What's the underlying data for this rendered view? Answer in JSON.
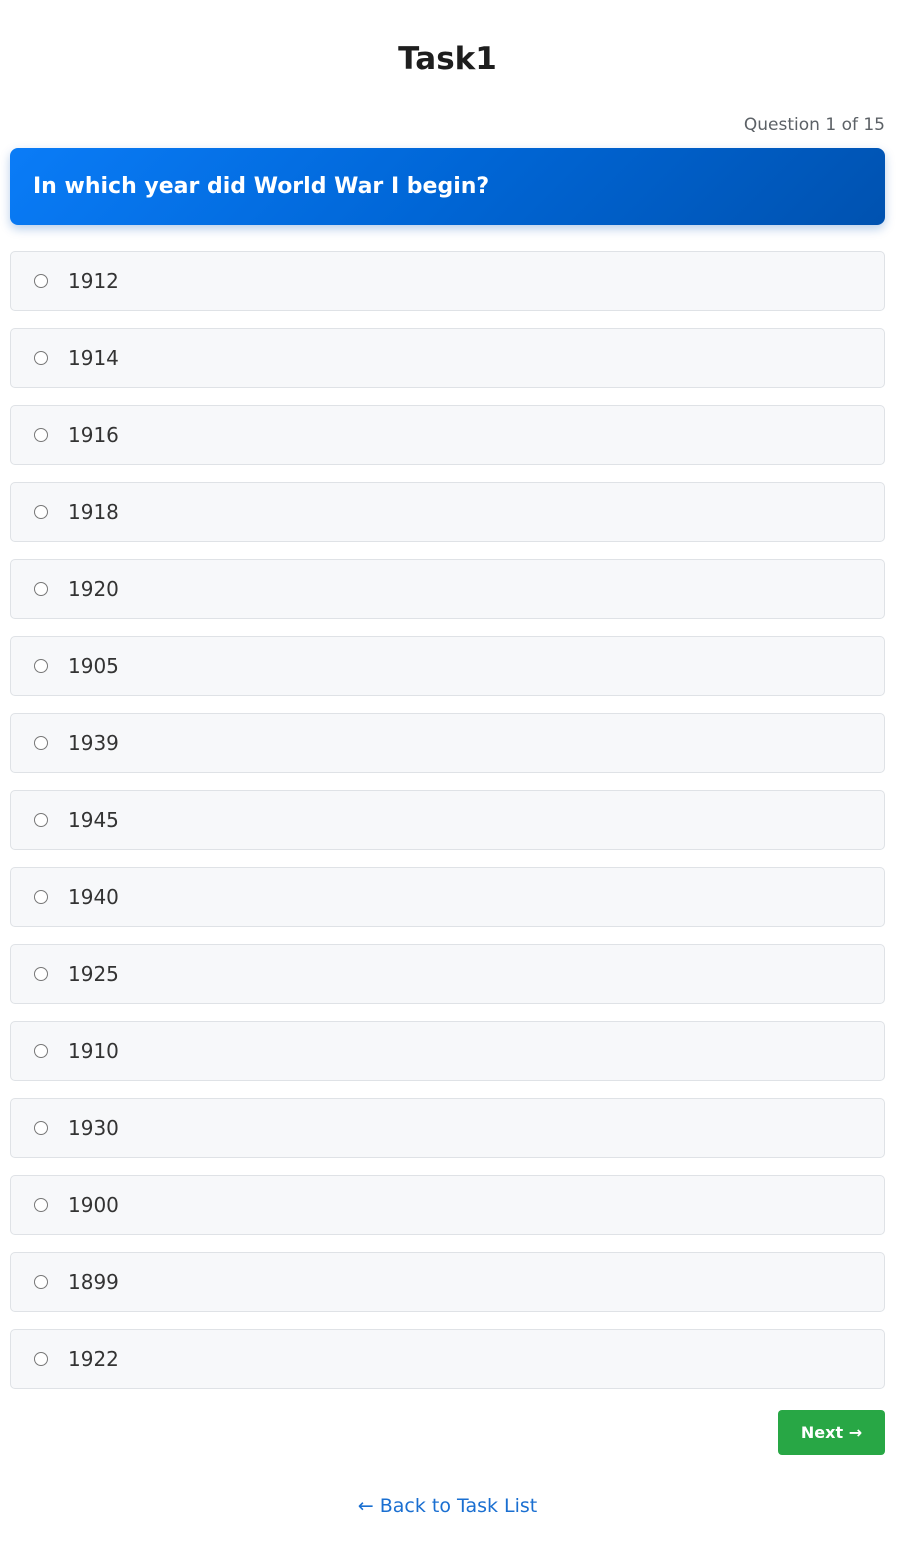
{
  "page": {
    "title": "Task1",
    "progress": "Question 1 of 15"
  },
  "question": {
    "text": "In which year did World War I begin?"
  },
  "options": [
    {
      "label": "1912"
    },
    {
      "label": "1914"
    },
    {
      "label": "1916"
    },
    {
      "label": "1918"
    },
    {
      "label": "1920"
    },
    {
      "label": "1905"
    },
    {
      "label": "1939"
    },
    {
      "label": "1945"
    },
    {
      "label": "1940"
    },
    {
      "label": "1925"
    },
    {
      "label": "1910"
    },
    {
      "label": "1930"
    },
    {
      "label": "1900"
    },
    {
      "label": "1899"
    },
    {
      "label": "1922"
    }
  ],
  "navigation": {
    "next_label": "Next →",
    "back_label": "← Back to Task List"
  },
  "colors": {
    "question_gradient_start": "#0a7cf7",
    "question_gradient_end": "#0052b0",
    "next_button": "#28a745",
    "link": "#1a6fd1"
  }
}
